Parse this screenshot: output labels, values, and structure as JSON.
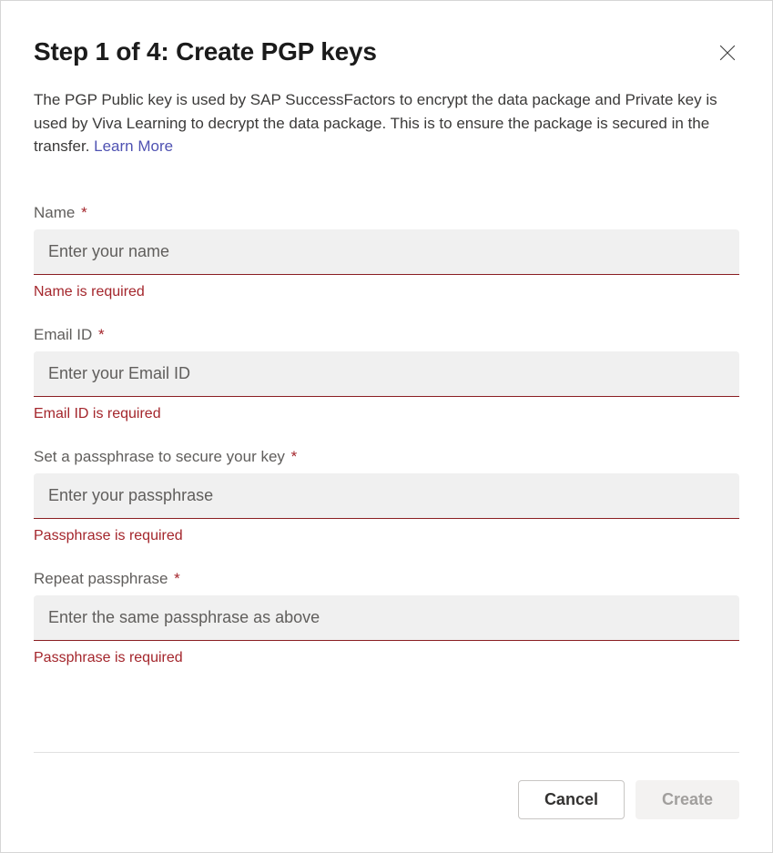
{
  "header": {
    "title": "Step 1 of 4: Create PGP keys"
  },
  "description": {
    "text": "The PGP Public key is used by SAP SuccessFactors to encrypt the data package and Private key is used by Viva Learning to decrypt the data package. This is to ensure the package is secured in the transfer. ",
    "learn_more": "Learn More"
  },
  "fields": {
    "name": {
      "label": "Name",
      "placeholder": "Enter your name",
      "error": "Name is required"
    },
    "email": {
      "label": "Email ID",
      "placeholder": "Enter your Email ID",
      "error": "Email ID is required"
    },
    "passphrase": {
      "label": "Set a passphrase to secure your key",
      "placeholder": "Enter your passphrase",
      "error": "Passphrase is required"
    },
    "repeat": {
      "label": "Repeat passphrase",
      "placeholder": "Enter the same passphrase as above",
      "error": "Passphrase is required"
    }
  },
  "buttons": {
    "cancel": "Cancel",
    "create": "Create"
  },
  "required_marker": "*"
}
